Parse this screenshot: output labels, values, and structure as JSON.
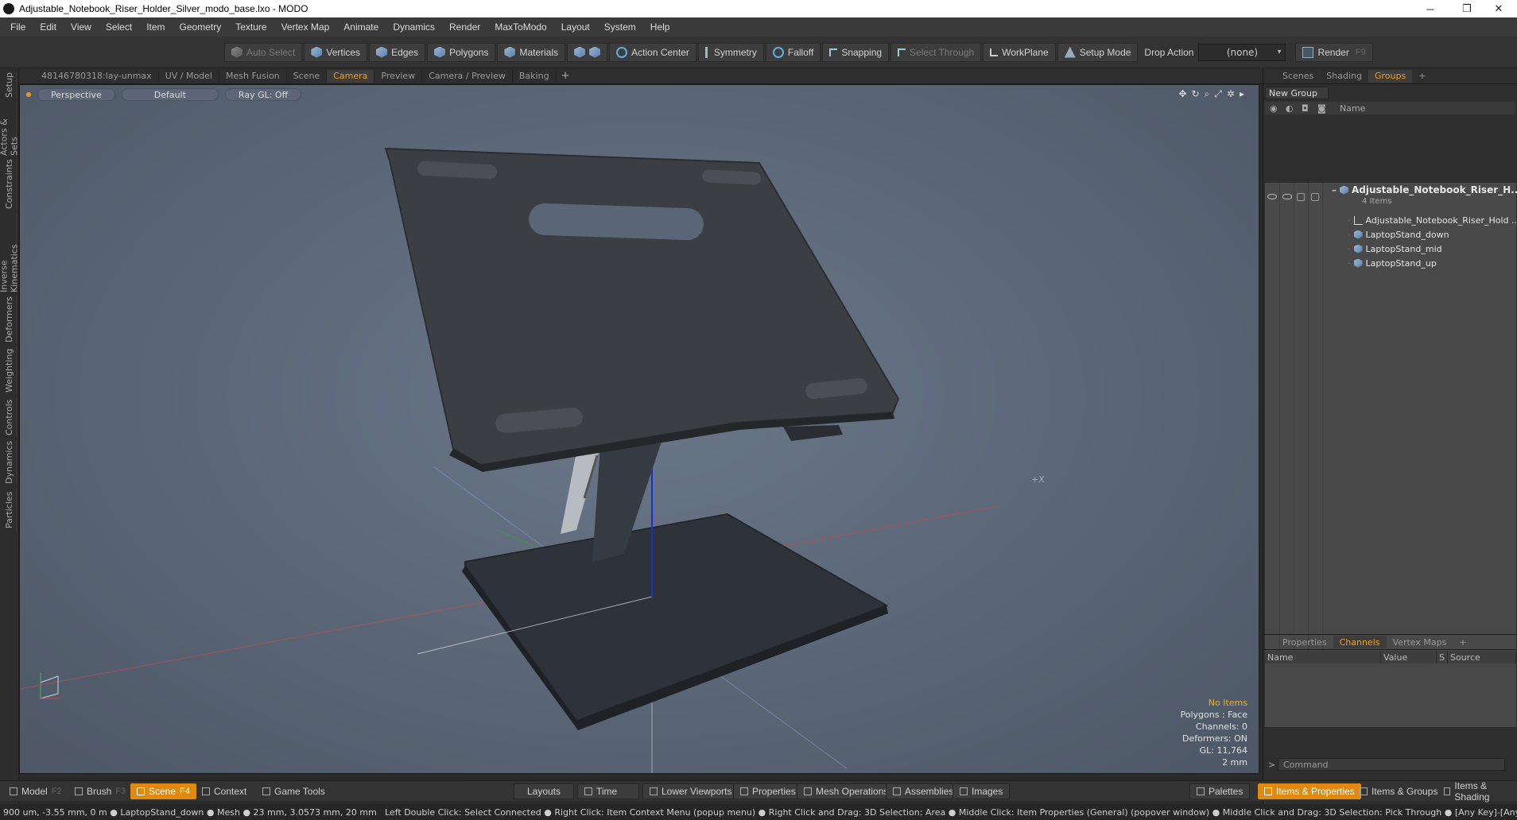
{
  "window": {
    "title": "Adjustable_Notebook_Riser_Holder_Silver_modo_base.lxo - MODO",
    "minimize": "─",
    "restore": "❐",
    "close": "✕"
  },
  "menu": [
    "File",
    "Edit",
    "View",
    "Select",
    "Item",
    "Geometry",
    "Texture",
    "Vertex Map",
    "Animate",
    "Dynamics",
    "Render",
    "MaxToModo",
    "Layout",
    "System",
    "Help"
  ],
  "toolbar": {
    "auto_select": "Auto Select",
    "vertices": "Vertices",
    "edges": "Edges",
    "polygons": "Polygons",
    "materials": "Materials",
    "action_center": "Action Center",
    "symmetry": "Symmetry",
    "falloff": "Falloff",
    "snapping": "Snapping",
    "select_through": "Select Through",
    "workplane": "WorkPlane",
    "setup_mode": "Setup Mode",
    "drop_action_label": "Drop Action",
    "drop_action_value": "(none)",
    "render": "Render",
    "render_key": "F9"
  },
  "left_tabs": [
    "Setup",
    "Actors & Sets",
    "Constraints",
    "Inverse Kinematics",
    "Deformers",
    "Weighting",
    "Controls",
    "Dynamics",
    "Particles"
  ],
  "viewport_tabs": [
    "48146780318:lay-unmax",
    "UV / Model",
    "Mesh Fusion",
    "Scene",
    "Camera",
    "Preview",
    "Camera / Preview",
    "Baking"
  ],
  "viewport_tab_add": "+",
  "viewport": {
    "view": "Perspective",
    "shading": "Default",
    "raygl": "Ray GL: Off",
    "stats": {
      "items": "No Items",
      "polygons": "Polygons : Face",
      "channels": "Channels: 0",
      "deformers": "Deformers: ON",
      "gl": "GL: 11,764",
      "scale": "2 mm"
    }
  },
  "right_panel": {
    "tabs": [
      "Scenes",
      "Shading",
      "Groups"
    ],
    "tab_add": "+",
    "new_group": "New Group",
    "name_header": "Name",
    "root": {
      "name": "Adjustable_Notebook_Riser_H...",
      "count": "4 Items"
    },
    "children": [
      "Adjustable_Notebook_Riser_Hold ...",
      "LaptopStand_down",
      "LaptopStand_mid",
      "LaptopStand_up"
    ],
    "channel_tabs": [
      "Properties",
      "Channels",
      "Vertex Maps"
    ],
    "channel_cols": [
      "Name",
      "Value",
      "S",
      "Source"
    ],
    "command_placeholder": "Command",
    "command_prompt": ">"
  },
  "bottom": {
    "model": "Model",
    "model_key": "F2",
    "brush": "Brush",
    "brush_key": "F3",
    "scene": "Scene",
    "scene_key": "F4",
    "context": "Context",
    "game_tools": "Game Tools",
    "layouts": "Layouts",
    "time": "Time",
    "lower_viewports": "Lower Viewports",
    "properties": "Properties",
    "mesh_operations": "Mesh Operations",
    "assemblies": "Assemblies",
    "images": "Images",
    "palettes": "Palettes",
    "items_properties": "Items & Properties",
    "items_groups": "Items & Groups",
    "items_shading": "Items & Shading"
  },
  "status": {
    "left": "900 um, -3.55 mm, 0 m ● LaptopStand_down ● Mesh ● 23 mm, 3.0573 mm, 20 mm",
    "right": "Left Double Click: Select Connected ● Right Click: Item Context Menu (popup menu) ● Right Click and Drag: 3D Selection: Area ● Middle Click: Item Properties (General) (popover window) ● Middle Click and Drag: 3D Selection: Pick Through ● [Any Key]-[Any Button] Click and Drag: dragDropB"
  },
  "colors": {
    "accent": "#e08a10",
    "active_tab": "#f0a020"
  }
}
